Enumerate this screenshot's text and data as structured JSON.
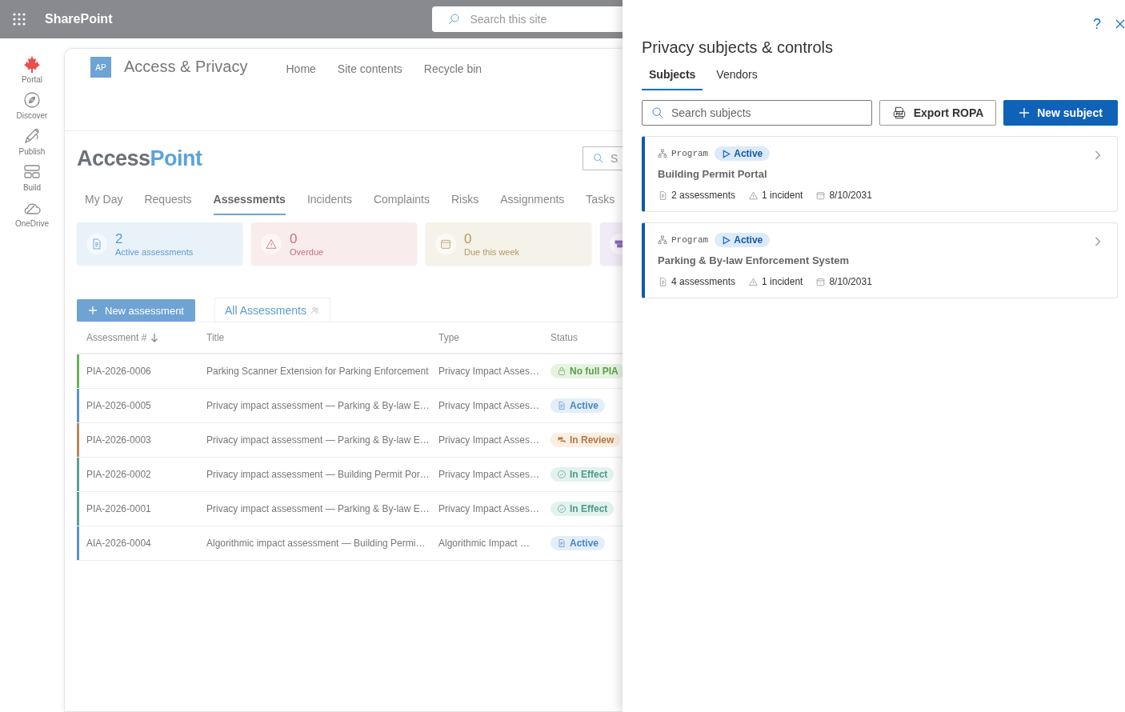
{
  "top_bar": {
    "brand": "SharePoint",
    "search": {
      "placeholder": "Search this site"
    }
  },
  "rail": [
    {
      "label": "Portal",
      "kind": "leaf"
    },
    {
      "label": "Discover",
      "kind": "compass"
    },
    {
      "label": "Publish",
      "kind": "pen"
    },
    {
      "label": "Build",
      "kind": "layout"
    },
    {
      "label": "OneDrive",
      "kind": "cloud"
    }
  ],
  "site": {
    "badge": "AP",
    "title": "Access & Privacy",
    "nav": [
      "Home",
      "Site contents",
      "Recycle bin"
    ]
  },
  "app": {
    "logo": {
      "part_1": "Access",
      "part_2": "Point"
    },
    "search": {
      "placeholder": "S"
    }
  },
  "tabs": [
    {
      "label": "My Day",
      "selected": false
    },
    {
      "label": "Requests",
      "selected": false
    },
    {
      "label": "Assessments",
      "selected": true
    },
    {
      "label": "Incidents",
      "selected": false
    },
    {
      "label": "Complaints",
      "selected": false
    },
    {
      "label": "Risks",
      "selected": false
    },
    {
      "label": "Assignments",
      "selected": false
    },
    {
      "label": "Tasks",
      "selected": false
    }
  ],
  "stats": [
    {
      "kind": "doc",
      "count": "2",
      "label": "Active assessments",
      "color": "#5b9bd5"
    },
    {
      "kind": "warning",
      "count": "0",
      "label": "Overdue",
      "color": "#c8707a"
    },
    {
      "kind": "calendar",
      "count": "0",
      "label": "Due this week",
      "color": "#b39b5e"
    },
    {
      "kind": "queue",
      "color": "#8d6bb8"
    }
  ],
  "new_button": "New assessment",
  "view": {
    "label": "All Assessments"
  },
  "table": {
    "columns": [
      {
        "label": "Assessment #",
        "sorted": true
      },
      {
        "label": "Title",
        "sorted": false
      },
      {
        "label": "Type",
        "sorted": false
      },
      {
        "label": "Status",
        "sorted": false
      }
    ],
    "rows": [
      {
        "id": "PIA-2026-0006",
        "title": "Parking Scanner Extension for Parking Enforcement",
        "type": "Privacy Impact Asses…",
        "status": {
          "label": "No full PIA",
          "kind": "lock"
        },
        "color": "#6aaf5c"
      },
      {
        "id": "PIA-2026-0005",
        "title": "Privacy impact assessment — Parking & By-law E…",
        "type": "Privacy Impact Asses…",
        "status": {
          "label": "Active",
          "kind": "doc"
        },
        "color": "#5b93c7"
      },
      {
        "id": "PIA-2026-0003",
        "title": "Privacy impact assessment — Parking & By-law E…",
        "type": "Privacy Impact Asses…",
        "status": {
          "label": "In Review",
          "kind": "chat"
        },
        "color": "#b58a5e"
      },
      {
        "id": "PIA-2026-0002",
        "title": "Privacy impact assessment — Building Permit Por…",
        "type": "Privacy Impact Asses…",
        "status": {
          "label": "In Effect",
          "kind": "check"
        },
        "color": "#5a9f94"
      },
      {
        "id": "PIA-2026-0001",
        "title": "Privacy impact assessment — Parking & By-law E…",
        "type": "Privacy Impact Asses…",
        "status": {
          "label": "In Effect",
          "kind": "check"
        },
        "color": "#5a9f94"
      },
      {
        "id": "AIA-2026-0004",
        "title": "Algorithmic impact assessment — Building Permi…",
        "type": "Algorithmic Impact …",
        "status": {
          "label": "Active",
          "kind": "doc"
        },
        "color": "#5b93c7"
      }
    ]
  },
  "panel": {
    "help": "?",
    "title": "Privacy subjects & controls",
    "tabs": [
      {
        "label": "Subjects",
        "selected": true
      },
      {
        "label": "Vendors",
        "selected": false
      }
    ],
    "search": {
      "placeholder": "Search subjects"
    },
    "export_button": "Export ROPA",
    "new_button": "New subject",
    "subjects": [
      {
        "kind": "Program",
        "status": "Active",
        "name": "Building Permit Portal",
        "assessments": "2 assessments",
        "incidents": "1 incident",
        "date": "8/10/2031"
      },
      {
        "kind": "Program",
        "status": "Active",
        "name": "Parking & By-law Enforcement System",
        "assessments": "4 assessments",
        "incidents": "1 incident",
        "date": "8/10/2031"
      }
    ]
  }
}
